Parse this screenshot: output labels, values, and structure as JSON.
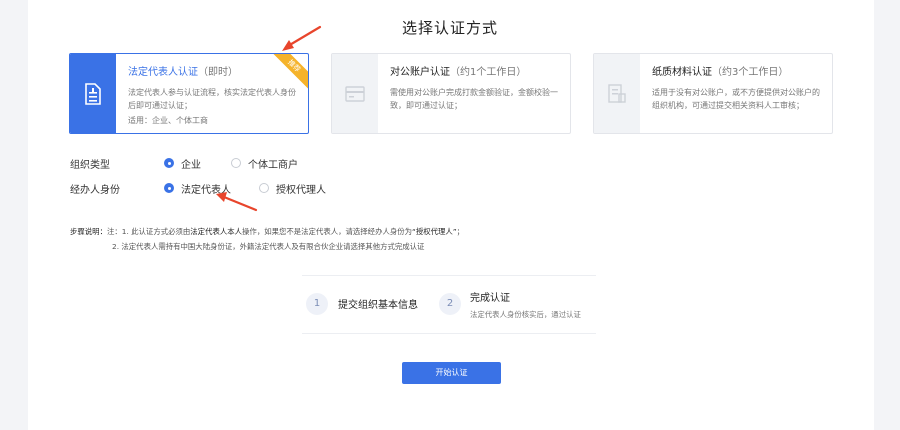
{
  "page": {
    "title": "选择认证方式"
  },
  "cards": [
    {
      "title": "法定代表人认证",
      "subtitle": "（即时）",
      "desc": "法定代表人参与认证流程，核实法定代表人身份后即可通过认证；",
      "use": "适用：企业、个体工商",
      "badge": "推荐",
      "icon": "document-icon",
      "selected": true
    },
    {
      "title": "对公账户认证",
      "subtitle": "（约1个工作日）",
      "desc": "需使用对公账户完成打款金额验证，金额校验一致，即可通过认证；",
      "icon": "card-icon",
      "selected": false
    },
    {
      "title": "纸质材料认证",
      "subtitle": "（约3个工作日）",
      "desc": "适用于没有对公账户，或不方便提供对公账户的组织机构，可通过提交相关资料人工审核；",
      "icon": "paper-icon",
      "selected": false
    }
  ],
  "org_type": {
    "label": "组织类型",
    "options": [
      "企业",
      "个体工商户"
    ],
    "selected": "企业"
  },
  "operator": {
    "label": "经办人身份",
    "options": [
      "法定代表人",
      "授权代理人"
    ],
    "selected": "法定代表人"
  },
  "notes": {
    "label": "步骤说明：",
    "line1_a": "注：1. 此认证方式必须由",
    "line1_b": "法定代表人本人",
    "line1_c": "操作，如果您不是法定代表人，请选择经办人身份为",
    "line1_d": "“授权代理人”",
    "line1_e": "；",
    "line2": "2. 法定代表人需持有中国大陆身份证，外籍法定代表人及有限合伙企业请选择其他方式完成认证"
  },
  "steps": [
    {
      "num": "1",
      "title": "提交组织基本信息"
    },
    {
      "num": "2",
      "title": "完成认证",
      "sub": "法定代表人身份核实后，通过认证"
    }
  ],
  "start_button": "开始认证",
  "colors": {
    "accent": "#3a72e6",
    "badge": "#f5b32b",
    "annotation_arrow": "#e8452c"
  }
}
